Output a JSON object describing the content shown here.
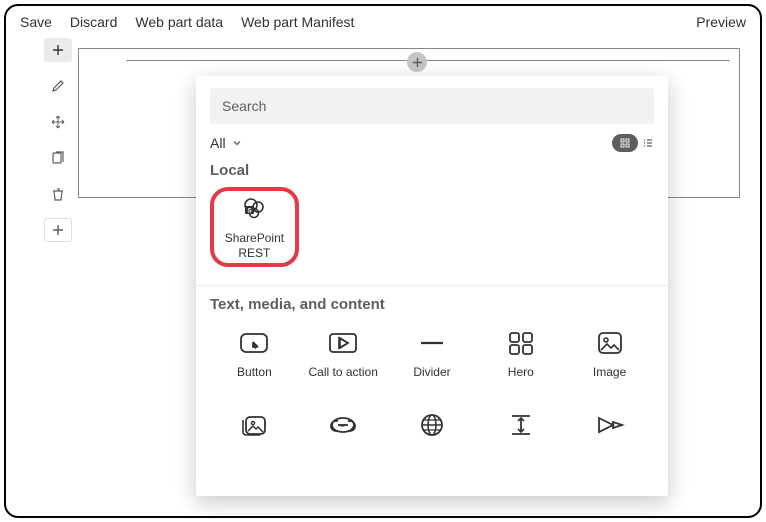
{
  "toolbar": {
    "save": "Save",
    "discard": "Discard",
    "webpartdata": "Web part data",
    "webpartmanifest": "Web part Manifest",
    "preview": "Preview"
  },
  "picker": {
    "search_placeholder": "Search",
    "filter_label": "All",
    "categories": {
      "local": "Local",
      "textmedia": "Text, media, and content"
    },
    "items": {
      "sharepoint_rest": {
        "label": "SharePoint\nREST"
      },
      "button": {
        "label": "Button"
      },
      "cta": {
        "label": "Call to action"
      },
      "divider": {
        "label": "Divider"
      },
      "hero": {
        "label": "Hero"
      },
      "image": {
        "label": "Image"
      }
    }
  }
}
